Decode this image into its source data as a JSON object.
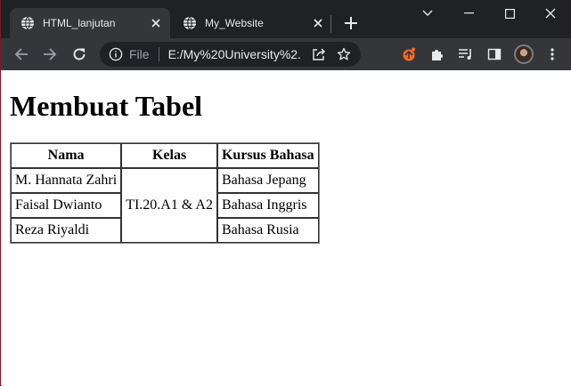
{
  "browser": {
    "tabs": [
      {
        "title": "HTML_lanjutan",
        "active": true
      },
      {
        "title": "My_Website",
        "active": false
      }
    ],
    "address": {
      "scheme": "File",
      "url": "E:/My%20University%2..."
    },
    "accent_colors": {
      "titlebar": "#202124",
      "toolbar": "#35363a",
      "extension_orange": "#f46a25"
    },
    "icons": [
      "globe-icon",
      "close-icon",
      "new-tab-icon",
      "minimize-icon",
      "maximize-icon",
      "window-close-icon",
      "tab-search-icon",
      "back-icon",
      "forward-icon",
      "reload-icon",
      "info-icon",
      "share-icon",
      "star-icon",
      "extension-icon",
      "puzzle-icon",
      "media-icon",
      "side-panel-icon",
      "avatar",
      "more-icon"
    ]
  },
  "page": {
    "heading": "Membuat Tabel",
    "table": {
      "headers": [
        "Nama",
        "Kelas",
        "Kursus Bahasa"
      ],
      "rows": [
        {
          "nama": "M. Hannata Zahri",
          "kursus": "Bahasa Jepang"
        },
        {
          "nama": "Faisal Dwianto",
          "kursus": "Bahasa Inggris"
        },
        {
          "nama": "Reza Riyaldi",
          "kursus": "Bahasa Rusia"
        }
      ],
      "kelas_merged": "TI.20.A1 & A2"
    }
  }
}
